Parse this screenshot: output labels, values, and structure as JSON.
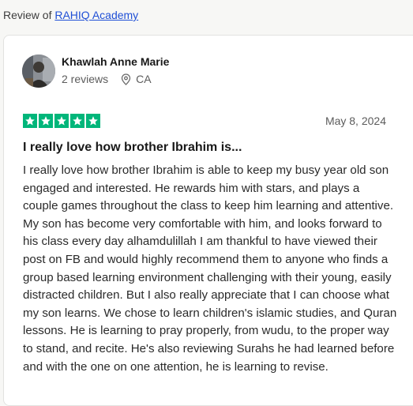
{
  "header": {
    "prefix": "Review of",
    "company_link": "RAHIQ Academy"
  },
  "reviewer": {
    "name": "Khawlah Anne Marie",
    "reviews_count": "2 reviews",
    "location": "CA"
  },
  "review": {
    "rating": 5,
    "rating_color": "#00b67a",
    "date": "May 8, 2024",
    "title": "I really love how brother Ibrahim is...",
    "body": "I really love how brother Ibrahim is able to keep my busy year old son engaged and interested. He rewards him with stars, and plays a couple games throughout the class to keep him learning and attentive. My son has become very comfortable with him, and looks forward to his class every day alhamdulillah I am thankful to have viewed their post on FB and would highly recommend them to anyone who finds a group based learning environment challenging with their young, easily distracted children. But I also really appreciate that I can choose what my son learns. We chose to learn children's islamic studies, and Quran lessons. He is learning to pray properly, from wudu, to the proper way to stand, and recite. He's also reviewing Surahs he had learned before and with the one on one attention, he is learning to revise."
  },
  "icons": {
    "location": "location-pin-icon",
    "star": "star-icon"
  }
}
